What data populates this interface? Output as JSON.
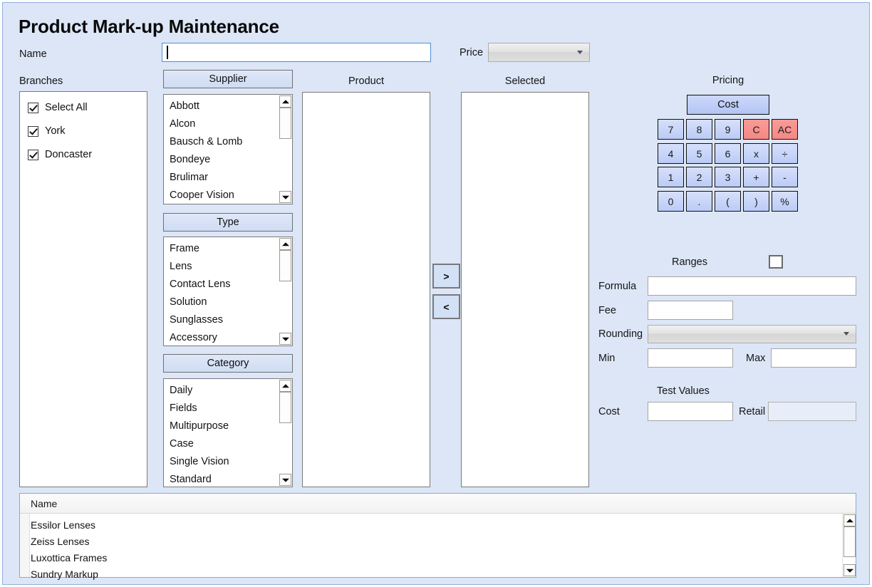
{
  "window": {
    "title": "Product Mark-up Maintenance"
  },
  "form": {
    "name_label": "Name",
    "name_value": "",
    "name_placeholder": "",
    "price_label": "Price",
    "price_value": "",
    "branches_label": "Branches"
  },
  "branches": {
    "items": [
      {
        "label": "Select All",
        "checked": true
      },
      {
        "label": "York",
        "checked": true
      },
      {
        "label": "Doncaster",
        "checked": true
      }
    ]
  },
  "supplier": {
    "header": "Supplier",
    "items": [
      "Abbott",
      "Alcon",
      "Bausch & Lomb",
      "Bondeye",
      "Brulimar",
      "Cooper Vision"
    ]
  },
  "type": {
    "header": "Type",
    "items": [
      "Frame",
      "Lens",
      "Contact Lens",
      "Solution",
      "Sunglasses",
      "Accessory"
    ]
  },
  "category": {
    "header": "Category",
    "items": [
      "Daily",
      "Fields",
      "Multipurpose",
      "Case",
      "Single Vision",
      "Standard"
    ]
  },
  "product": {
    "header": "Product",
    "items": []
  },
  "selected": {
    "header": "Selected",
    "items": []
  },
  "transfer": {
    "add_label": ">",
    "remove_label": "<"
  },
  "pricing": {
    "header": "Pricing",
    "cost_label": "Cost",
    "keys": [
      {
        "label": "7",
        "kind": "digit"
      },
      {
        "label": "8",
        "kind": "digit"
      },
      {
        "label": "9",
        "kind": "digit"
      },
      {
        "label": "C",
        "kind": "clear"
      },
      {
        "label": "AC",
        "kind": "clear"
      },
      {
        "label": "4",
        "kind": "digit"
      },
      {
        "label": "5",
        "kind": "digit"
      },
      {
        "label": "6",
        "kind": "digit"
      },
      {
        "label": "x",
        "kind": "op"
      },
      {
        "label": "÷",
        "kind": "op"
      },
      {
        "label": "1",
        "kind": "digit"
      },
      {
        "label": "2",
        "kind": "digit"
      },
      {
        "label": "3",
        "kind": "digit"
      },
      {
        "label": "+",
        "kind": "op"
      },
      {
        "label": "-",
        "kind": "op"
      },
      {
        "label": "0",
        "kind": "digit"
      },
      {
        "label": ".",
        "kind": "digit"
      },
      {
        "label": "(",
        "kind": "op"
      },
      {
        "label": ")",
        "kind": "op"
      },
      {
        "label": "%",
        "kind": "op"
      }
    ]
  },
  "ranges": {
    "label": "Ranges",
    "checked": false,
    "formula_label": "Formula",
    "formula_value": "",
    "fee_label": "Fee",
    "fee_value": "",
    "rounding_label": "Rounding",
    "rounding_value": "",
    "min_label": "Min",
    "min_value": "",
    "max_label": "Max",
    "max_value": ""
  },
  "test_values": {
    "header": "Test Values",
    "cost_label": "Cost",
    "cost_value": "",
    "retail_label": "Retail",
    "retail_value": ""
  },
  "grid": {
    "columns": [
      "Name"
    ],
    "rows": [
      {
        "name": "Essilor Lenses"
      },
      {
        "name": "Zeiss Lenses"
      },
      {
        "name": "Luxottica Frames"
      },
      {
        "name": "Sundry Markup"
      }
    ]
  },
  "colors": {
    "background": "#dce6f7",
    "frame_border": "#8cb0dd",
    "key_blue": "#c6d3f8",
    "key_red": "#f8918c",
    "focus_border": "#4b90d4"
  }
}
